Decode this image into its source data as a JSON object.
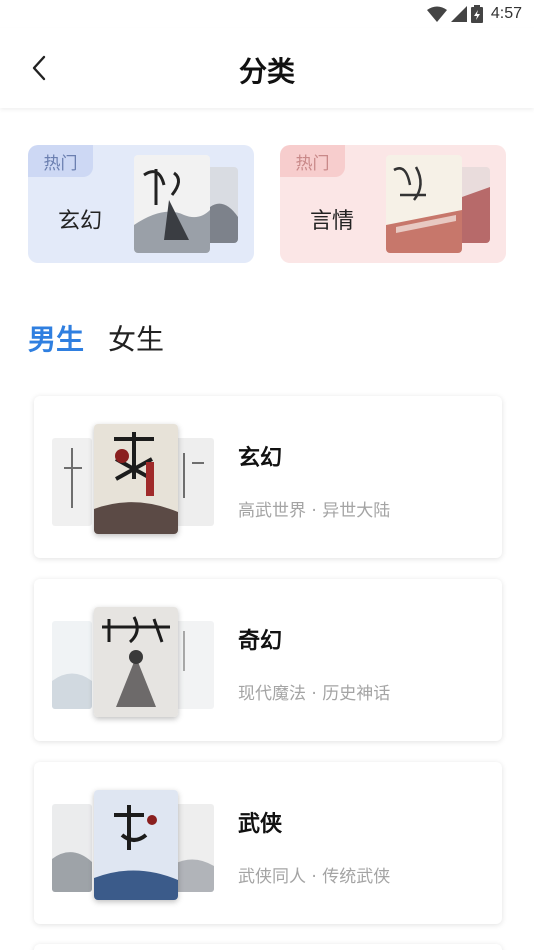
{
  "status": {
    "time": "4:57"
  },
  "header": {
    "title": "分类"
  },
  "hot": [
    {
      "tag": "热门",
      "name": "玄幻",
      "theme": "blue"
    },
    {
      "tag": "热门",
      "name": "言情",
      "theme": "pink"
    }
  ],
  "gender_tabs": [
    {
      "label": "男生",
      "active": true
    },
    {
      "label": "女生",
      "active": false
    }
  ],
  "categories": [
    {
      "name": "玄幻",
      "sub": "高武世界 · 异世大陆"
    },
    {
      "name": "奇幻",
      "sub": "现代魔法 · 历史神话"
    },
    {
      "name": "武侠",
      "sub": "武侠同人 · 传统武侠"
    }
  ],
  "colors": {
    "accent": "#2f7fe0",
    "hot_blue_bg": "#e3eaf9",
    "hot_pink_bg": "#fbe6e6",
    "subtext": "#a4a4a4"
  }
}
